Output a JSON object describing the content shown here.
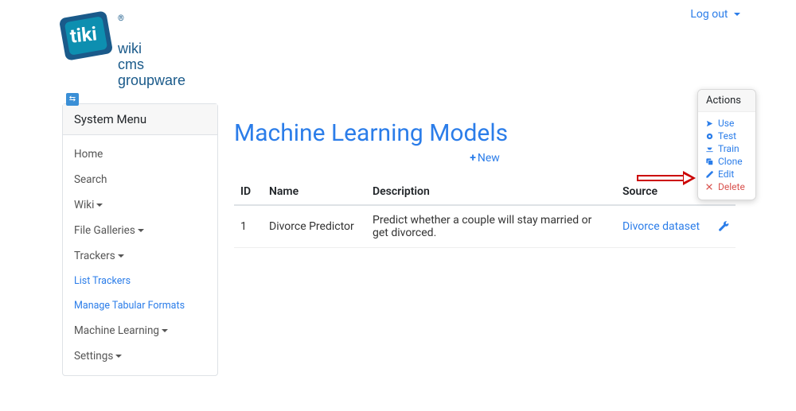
{
  "header": {
    "logout_label": "Log out",
    "logo_text": "tiki",
    "logo_sub1": "wiki",
    "logo_sub2": "cms",
    "logo_sub3": "groupware"
  },
  "sidebar": {
    "title": "System Menu",
    "items": [
      {
        "label": "Home",
        "dropdown": false,
        "link": false
      },
      {
        "label": "Search",
        "dropdown": false,
        "link": false
      },
      {
        "label": "Wiki",
        "dropdown": true,
        "link": false
      },
      {
        "label": "File Galleries",
        "dropdown": true,
        "link": false
      },
      {
        "label": "Trackers",
        "dropdown": true,
        "link": false
      },
      {
        "label": "List Trackers",
        "dropdown": false,
        "link": true
      },
      {
        "label": "Manage Tabular Formats",
        "dropdown": false,
        "link": true
      },
      {
        "label": "Machine Learning",
        "dropdown": true,
        "link": false
      },
      {
        "label": "Settings",
        "dropdown": true,
        "link": false
      }
    ]
  },
  "main": {
    "title": "Machine Learning Models",
    "new_label": "New",
    "columns": {
      "id": "ID",
      "name": "Name",
      "description": "Description",
      "source": "Source"
    },
    "rows": [
      {
        "id": "1",
        "name": "Divorce Predictor",
        "description": "Predict whether a couple will stay married or get divorced.",
        "source": "Divorce dataset"
      }
    ]
  },
  "popover": {
    "title": "Actions",
    "items": [
      {
        "icon": "arrow-icon",
        "label": "Use",
        "kind": "normal"
      },
      {
        "icon": "circle-icon",
        "label": "Test",
        "kind": "normal"
      },
      {
        "icon": "train-icon",
        "label": "Train",
        "kind": "normal"
      },
      {
        "icon": "clone-icon",
        "label": "Clone",
        "kind": "normal"
      },
      {
        "icon": "edit-icon",
        "label": "Edit",
        "kind": "normal"
      },
      {
        "icon": "x-icon",
        "label": "Delete",
        "kind": "delete"
      }
    ]
  }
}
